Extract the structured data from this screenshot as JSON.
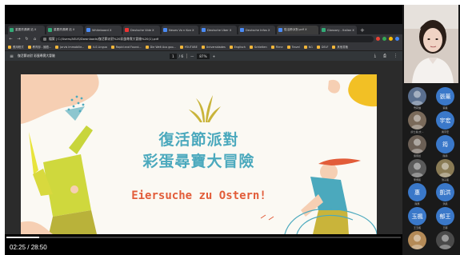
{
  "browser": {
    "tabs": [
      {
        "label": "重要資源網 站 X",
        "icon": "doc",
        "active": false
      },
      {
        "label": "重要資源網 站 X",
        "icon": "doc",
        "active": false
      },
      {
        "label": "Whiteboard X",
        "icon": "page",
        "active": false
      },
      {
        "label": "Deutsche Vide X",
        "icon": "yt",
        "active": false
      },
      {
        "label": "Neues Vo n Kon X",
        "icon": "page",
        "active": false
      },
      {
        "label": "Deutsche Über X",
        "icon": "page",
        "active": false
      },
      {
        "label": "Deutsche Infos X",
        "icon": "page",
        "active": false
      },
      {
        "label": "復活節派對.pdf X",
        "icon": "page",
        "active": true
      },
      {
        "label": "Glossary - Italian X",
        "icon": "doc",
        "active": false
      }
    ],
    "new_tab": "+",
    "nav": {
      "back": "←",
      "forward": "→",
      "reload": "↻",
      "home": "⌂"
    },
    "url": "檔案 | C:/Users/ASUS/Downloads/復活節派對%20彩蛋尋寶大冒險%20(1).pdf",
    "bookmarks": [
      "應用程式",
      "教育部 - 國語...",
      "Jarvis Immobilie...",
      "ILS Lingua",
      "Rapid and Found...",
      "Die Welt Aus goo...",
      "YOUTUBE",
      "Universidades",
      "Englisch",
      "Schleiten",
      "Filme",
      "Travel",
      "NG",
      "DELF",
      "其他書籤"
    ],
    "extensions": [
      "#e94235",
      "#34a853",
      "#fbbc04",
      "#4285f4"
    ]
  },
  "pdf_viewer": {
    "menu_icon": "≡",
    "title": "復活節派對 彩蛋尋寶大冒險",
    "page_current": "1",
    "page_total": "/ 6",
    "zoom_minus": "—",
    "zoom": "87%",
    "zoom_plus": "+",
    "download_icon": "⤓",
    "print_icon": "⎙",
    "more_icon": "⋮"
  },
  "slide": {
    "title_line1": "復活節派對",
    "title_line2": "彩蛋尋寶大冒險",
    "subtitle": "Eiersuche zu Ostern!",
    "colors": {
      "teal": "#4ba9bd",
      "orange": "#e25c39",
      "yellow": "#f2c025",
      "peach": "#f6cfb3",
      "green": "#b9b23a"
    }
  },
  "player": {
    "time": "02:25 / 28:50",
    "progress_fraction": 0.084
  },
  "participants": [
    {
      "initials": "",
      "name": "雪莉貓",
      "color": "#5a6f8e",
      "kind": "photo"
    },
    {
      "initials": "張薰",
      "name": "張薰",
      "color": "#3a78c9",
      "kind": "text"
    },
    {
      "initials": "",
      "name": "廖士嘉(文...",
      "color": "#7a6a5a",
      "kind": "photo"
    },
    {
      "initials": "宇宏",
      "name": "黃宇宏",
      "color": "#3a78c9",
      "kind": "text"
    },
    {
      "initials": "",
      "name": "吳家銓",
      "color": "#6b5f55",
      "kind": "photo"
    },
    {
      "initials": "筠",
      "name": "陳筠",
      "color": "#3a78c9",
      "kind": "text"
    },
    {
      "initials": "",
      "name": "李博凱",
      "color": "#5b5b5b",
      "kind": "photo"
    },
    {
      "initials": "",
      "name": "洪子凱",
      "color": "#8a7b55",
      "kind": "photo"
    },
    {
      "initials": "惠",
      "name": "陳惠",
      "color": "#3a78c9",
      "kind": "text"
    },
    {
      "initials": "凱洪",
      "name": "洪凱",
      "color": "#3a78c9",
      "kind": "text"
    },
    {
      "initials": "玉楓",
      "name": "王玉楓",
      "color": "#3a78c9",
      "kind": "text"
    },
    {
      "initials": "郁王",
      "name": "王郁",
      "color": "#3a78c9",
      "kind": "text"
    },
    {
      "initials": "",
      "name": "",
      "color": "#b48a57",
      "kind": "photo"
    },
    {
      "initials": "",
      "name": "",
      "color": "#4a4a4a",
      "kind": "photo"
    }
  ]
}
